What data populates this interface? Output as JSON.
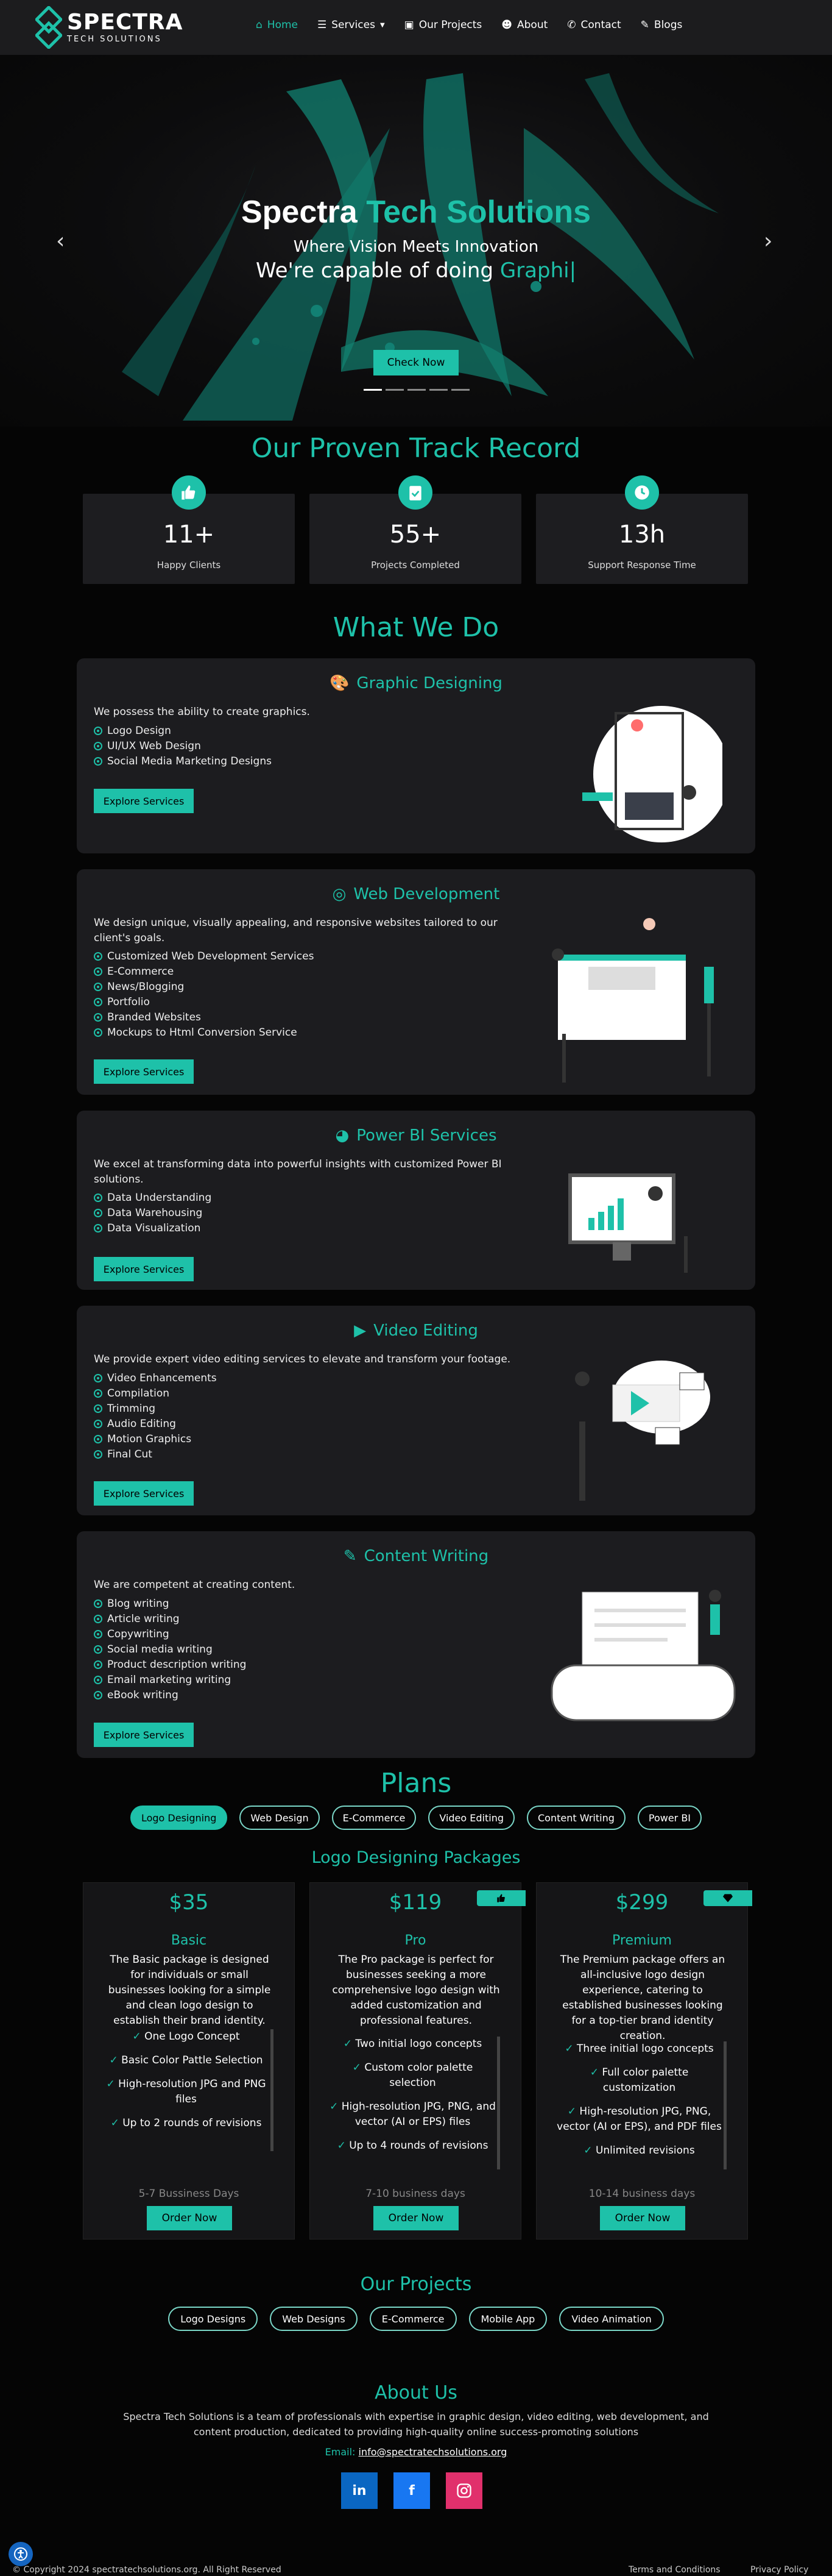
{
  "brand": {
    "name": "SPECTRA",
    "tagline": "TECH SOLUTIONS"
  },
  "nav": {
    "items": [
      "Home",
      "Services",
      "Our Projects",
      "About",
      "Contact",
      "Blogs"
    ]
  },
  "hero": {
    "title_a": "Spectra",
    "title_b": "Tech Solutions",
    "subtitle": "Where Vision Meets Innovation",
    "line_a": "We're capable of doing",
    "line_b": "Graphi|",
    "button": "Check Now"
  },
  "stats": {
    "title": "Our Proven Track Record",
    "items": [
      {
        "value": "11+",
        "label": "Happy Clients",
        "icon": "thumbs-up-icon"
      },
      {
        "value": "55+",
        "label": "Projects Completed",
        "icon": "clipboard-check-icon"
      },
      {
        "value": "13h",
        "label": "Support Response Time",
        "icon": "clock-icon"
      }
    ]
  },
  "services": {
    "title": "What We Do",
    "button": "Explore Services",
    "items": [
      {
        "title": "Graphic Designing",
        "desc": "We possess the ability to create graphics.",
        "list": [
          "Logo Design",
          "UI/UX Web Design",
          "Social Media Marketing Designs"
        ]
      },
      {
        "title": "Web Development",
        "desc": "We design unique, visually appealing, and responsive websites tailored to our client's goals.",
        "list": [
          "Customized Web Development Services",
          "E-Commerce",
          "News/Blogging",
          "Portfolio",
          "Branded Websites",
          "Mockups to Html Conversion Service"
        ]
      },
      {
        "title": "Power BI Services",
        "desc": "We excel at transforming data into powerful insights with customized Power BI solutions.",
        "list": [
          "Data Understanding",
          "Data Warehousing",
          "Data Visualization"
        ]
      },
      {
        "title": "Video Editing",
        "desc": "We provide expert video editing services to elevate and transform your footage.",
        "list": [
          "Video Enhancements",
          "Compilation",
          "Trimming",
          "Audio Editing",
          "Motion Graphics",
          "Final Cut"
        ]
      },
      {
        "title": "Content Writing",
        "desc": "We are competent at creating content.",
        "list": [
          "Blog writing",
          "Article writing",
          "Copywriting",
          "Social media writing",
          "Product description writing",
          "Email marketing writing",
          "eBook writing"
        ]
      }
    ]
  },
  "plans": {
    "title": "Plans",
    "tabs": [
      "Logo Designing",
      "Web Design",
      "E-Commerce",
      "Video Editing",
      "Content Writing",
      "Power BI"
    ],
    "subtitle": "Logo Designing Packages",
    "order": "Order Now",
    "packages": [
      {
        "price": "$35",
        "name": "Basic",
        "desc": "The Basic package is designed for individuals or small businesses looking for a simple and clean logo design to establish their brand identity.",
        "features": [
          "One Logo Concept",
          "Basic Color Pattle Selection",
          "High-resolution JPG and PNG files",
          "Up to 2 rounds of revisions"
        ],
        "days": "5-7 Bussiness Days"
      },
      {
        "price": "$119",
        "name": "Pro",
        "desc": "The Pro package is perfect for businesses seeking a more comprehensive logo design with added customization and professional features.",
        "features": [
          "Two initial logo concepts",
          "Custom color palette selection",
          "High-resolution JPG, PNG, and vector (AI or EPS) files",
          "Up to 4 rounds of revisions"
        ],
        "days": "7-10 business days"
      },
      {
        "price": "$299",
        "name": "Premium",
        "desc": "The Premium package offers an all-inclusive logo design experience, catering to established businesses looking for a top-tier brand identity creation.",
        "features": [
          "Three initial logo concepts",
          "Full color palette customization",
          "High-resolution JPG, PNG, vector (AI or EPS), and PDF files",
          "Unlimited revisions"
        ],
        "days": "10-14 business days"
      }
    ]
  },
  "projects": {
    "title": "Our Projects",
    "tabs": [
      "Logo Designs",
      "Web Designs",
      "E-Commerce",
      "Mobile App",
      "Video Animation"
    ]
  },
  "about": {
    "title": "About Us",
    "text1": "Spectra Tech Solutions is a team of professionals with expertise in graphic design, video editing, web development, and",
    "text2": "content production, dedicated to providing high-quality online success-promoting solutions",
    "email_label": "Email:",
    "email": "info@spectratechsolutions.org"
  },
  "footer": {
    "copyright": "© Copyright 2024 spectratechsolutions.org. All Right Reserved",
    "terms": "Terms and Conditions",
    "privacy": "Privacy Policy"
  },
  "colors": {
    "accent": "#1ec1a9",
    "card": "#1c1c1f",
    "bg": "#050505"
  }
}
